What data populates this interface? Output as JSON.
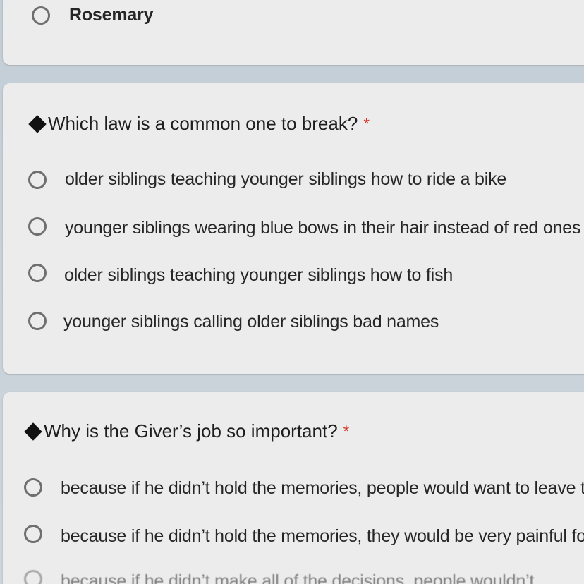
{
  "prev_question": {
    "options": [
      {
        "label": "Rosemary"
      }
    ]
  },
  "questions": [
    {
      "title": "Which law is a common one to break?",
      "required_mark": "*",
      "options": [
        {
          "label": "older siblings teaching younger siblings how to ride a bike"
        },
        {
          "label": "younger siblings wearing blue bows in their hair instead of red ones"
        },
        {
          "label": "older siblings teaching younger siblings how to fish"
        },
        {
          "label": "younger siblings calling older siblings bad names"
        }
      ]
    },
    {
      "title": "Why is the Giver’s job so important?",
      "required_mark": "*",
      "options": [
        {
          "label": "because if he didn’t hold the memories, people would want to leave th"
        },
        {
          "label": "because if he didn’t hold the memories, they would be very painful for"
        },
        {
          "label": "because if he didn’t make all of the decisions, people wouldn’t"
        }
      ]
    }
  ],
  "colors": {
    "background": "#c9d3da",
    "card": "#ececec",
    "radio_border": "#6f6f6f",
    "required": "#d93025",
    "text": "#262626"
  }
}
